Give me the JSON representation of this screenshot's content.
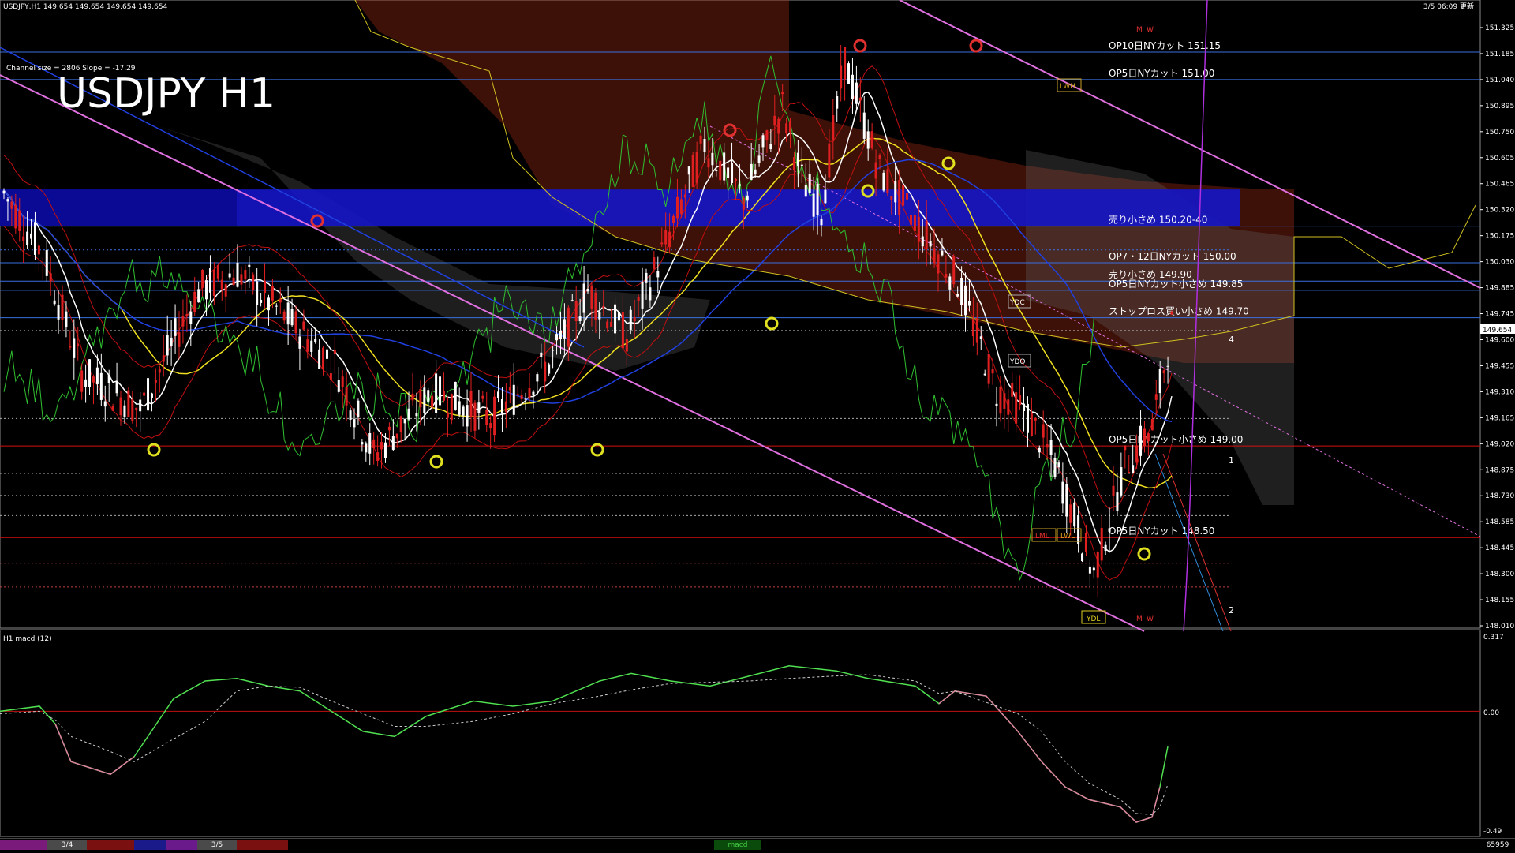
{
  "header": {
    "info": "USDJPY,H1  149.654 149.654 149.654 149.654",
    "datetime": "3/5 06:09 更新",
    "channel_info": "Channel size = 2806 Slope = -17.29",
    "big_title": "USDJPY H1"
  },
  "price_axis": {
    "labels": [
      "151.325",
      "151.185",
      "151.040",
      "150.895",
      "150.750",
      "150.605",
      "150.465",
      "150.320",
      "150.175",
      "150.030",
      "149.885",
      "149.745",
      "149.600",
      "149.455",
      "149.310",
      "149.165",
      "149.020",
      "148.875",
      "148.730",
      "148.585",
      "148.445",
      "148.300",
      "148.155",
      "148.010"
    ],
    "current_price": "149.654",
    "range": [
      148.01,
      151.4
    ]
  },
  "levels": [
    {
      "label": "OP10日NYカット 151.15",
      "price": 151.15,
      "color": "#3a6fe0"
    },
    {
      "label": "OP5日NYカット 151.00",
      "price": 151.0,
      "color": "#3a6fe0"
    },
    {
      "label": "売り小さめ 150.20-40",
      "price": 150.2,
      "color": "#3a6fe0"
    },
    {
      "label": "OP7・12日NYカット 150.00",
      "price": 150.0,
      "color": "#3a6fe0"
    },
    {
      "label": "売り小さめ 149.90",
      "price": 149.9,
      "color": "#3a6fe0"
    },
    {
      "label": "OP5日NYカット小さめ 149.85",
      "price": 149.85,
      "color": "#3a6fe0"
    },
    {
      "label": "ストップロス買い小さめ 149.70",
      "price": 149.7,
      "color": "#3a6fe0"
    },
    {
      "label": "OP5日NYカット小さめ 149.00",
      "price": 149.0,
      "color": "#d01010"
    },
    {
      "label": "OP5日NYカット 148.50",
      "price": 148.5,
      "color": "#d01010"
    }
  ],
  "markers": {
    "ydc": "YDC",
    "ydo": "YDO",
    "ydl": "YDL",
    "lwh": "LWH",
    "lml": "LML",
    "lwl": "LWL",
    "m": "M",
    "w": "W",
    "n1": "1",
    "n2": "2",
    "n4": "4"
  },
  "macd": {
    "title": "H1  macd (12)",
    "top_label": "0.317",
    "zero_label": "0.00",
    "bottom_label": "-0.49"
  },
  "bottom_bar": {
    "date1": "3/4",
    "date2": "3/5",
    "tab": "macd",
    "right_num": "65959"
  },
  "colors": {
    "up": "#ffffff",
    "down": "#e02020",
    "cloud": "#b03018",
    "band": "#1515c8",
    "sma_yellow": "#f0e020",
    "sma_white": "#ffffff",
    "macd_main": "#50e050",
    "macd_neg": "#e080a0",
    "channel": "#e070e0"
  }
}
